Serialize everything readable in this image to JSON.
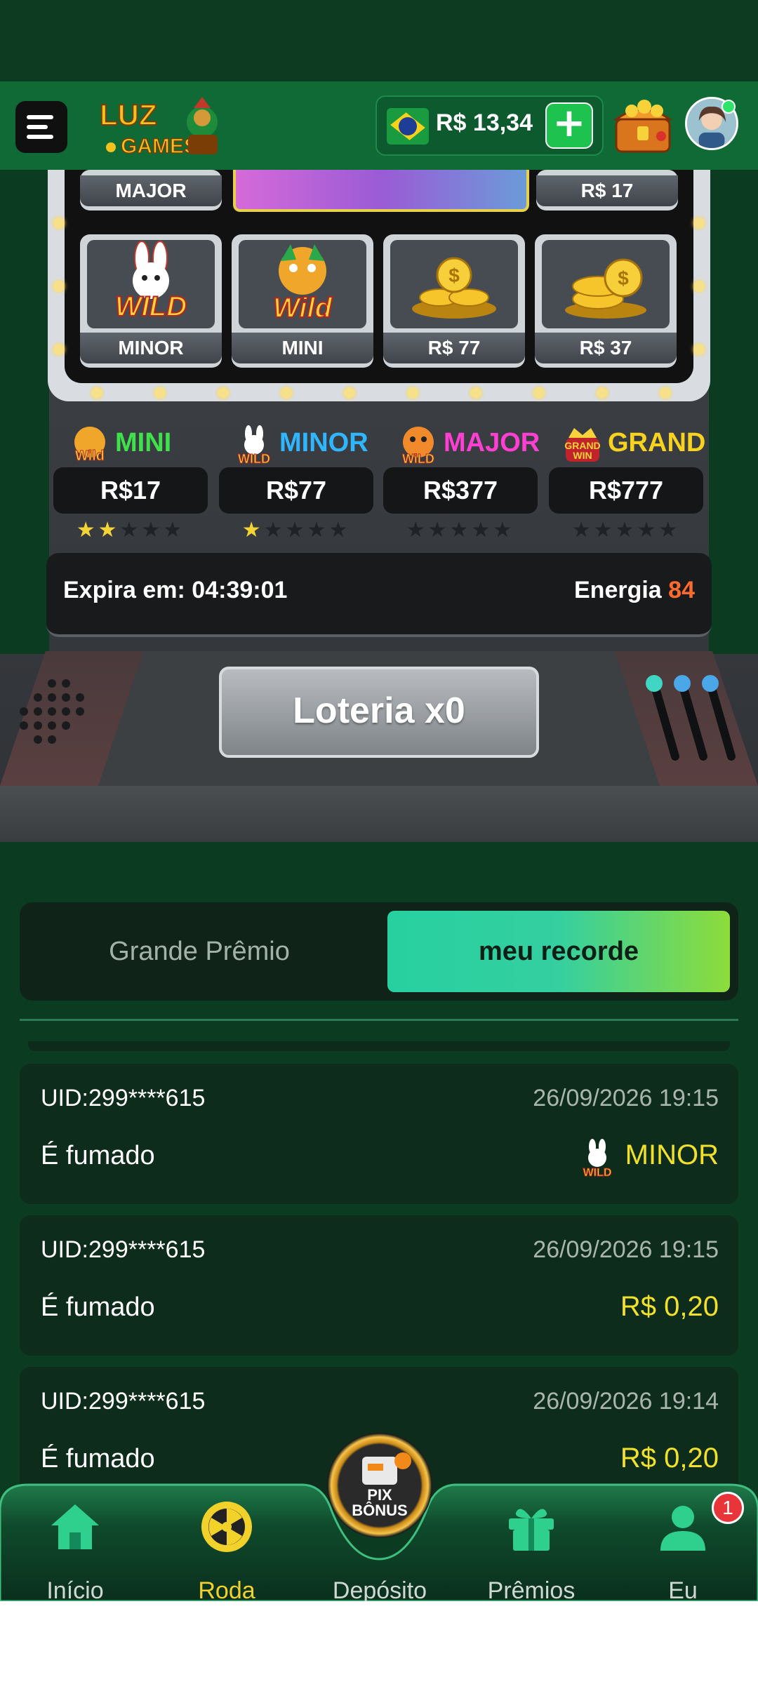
{
  "header": {
    "balance": "R$ 13,34",
    "plus_label": "+",
    "logo_text_top": "LUZ",
    "logo_text_bottom": "GAMES"
  },
  "machine": {
    "top_tiles": [
      {
        "label": "MAJOR"
      },
      {
        "label": "R$ 17"
      }
    ],
    "tiles": [
      {
        "label": "MINOR",
        "icon": "wild-rabbit-icon"
      },
      {
        "label": "MINI",
        "icon": "wild-dragon-icon"
      },
      {
        "label": "R$ 77",
        "icon": "gold-coins-icon"
      },
      {
        "label": "R$ 37",
        "icon": "gold-coins-icon"
      }
    ],
    "jackpots": [
      {
        "name": "MINI",
        "value": "R$17",
        "stars_filled": 2,
        "stars_total": 5,
        "color": "#3fe24a",
        "icon": "wild-dragon-icon"
      },
      {
        "name": "MINOR",
        "value": "R$77",
        "stars_filled": 1,
        "stars_total": 5,
        "color": "#2fb6ff",
        "icon": "wild-rabbit-icon"
      },
      {
        "name": "MAJOR",
        "value": "R$377",
        "stars_filled": 0,
        "stars_total": 5,
        "color": "#ff3fd2",
        "icon": "wild-tiger-icon"
      },
      {
        "name": "GRAND",
        "value": "R$777",
        "stars_filled": 0,
        "stars_total": 5,
        "color": "#f7d21f",
        "icon": "grand-win-icon"
      }
    ],
    "expira_label": "Expira em: 04:39:01",
    "energia_label": "Energia",
    "energia_value": "84",
    "lottery_button": "Loteria x0"
  },
  "tabs": [
    {
      "label": "Grande Prêmio",
      "active": false
    },
    {
      "label": "meu recorde",
      "active": true
    }
  ],
  "records": [
    {
      "uid": "UID:299****615",
      "time": "26/09/2026 19:15",
      "status": "É fumado",
      "prize": "MINOR",
      "prize_icon": "wild-rabbit-icon"
    },
    {
      "uid": "UID:299****615",
      "time": "26/09/2026 19:15",
      "status": "É fumado",
      "prize": "R$ 0,20"
    },
    {
      "uid": "UID:299****615",
      "time": "26/09/2026 19:14",
      "status": "É fumado",
      "prize": "R$ 0,20"
    }
  ],
  "nav": [
    {
      "label": "Início",
      "icon": "home-icon",
      "active": false
    },
    {
      "label": "Roda",
      "icon": "wheel-icon",
      "active": true
    },
    {
      "label": "Depósito",
      "icon": "pix-bonus-icon",
      "active": false
    },
    {
      "label": "Prêmios",
      "icon": "gift-icon",
      "active": false
    },
    {
      "label": "Eu",
      "icon": "user-icon",
      "active": false
    }
  ],
  "nav_badge": "1",
  "pix_text_top": "PIX",
  "pix_text_bottom": "BÔNUS",
  "colors": {
    "accent_green": "#1dc24f",
    "active_nav": "#f2d22a",
    "prize_yellow": "#f2e12a",
    "energy_orange": "#ff6a2f"
  }
}
